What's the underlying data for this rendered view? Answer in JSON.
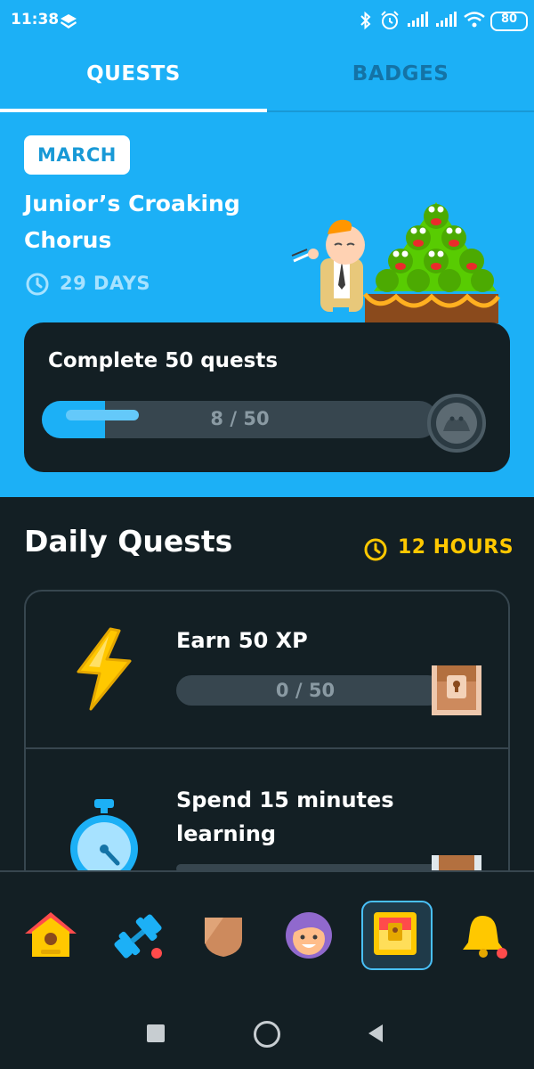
{
  "status_bar": {
    "time": "11:38",
    "battery": "80"
  },
  "tabs": [
    {
      "label": "QUESTS",
      "active": true
    },
    {
      "label": "BADGES",
      "active": false
    }
  ],
  "monthly_challenge": {
    "month": "MARCH",
    "title": "Junior’s Croaking Chorus",
    "days_left": "29 DAYS",
    "card_title": "Complete 50 quests",
    "progress_text": "8 / 50",
    "progress_fraction": 0.16
  },
  "daily_quests": {
    "title": "Daily Quests",
    "time_left": "12 HOURS",
    "items": [
      {
        "title": "Earn 50 XP",
        "progress_text": "0 / 50",
        "progress_fraction": 0,
        "icon": "lightning-icon"
      },
      {
        "title": "Spend 15 minutes learning",
        "icon": "stopwatch-icon"
      }
    ]
  },
  "bottom_nav": [
    {
      "name": "home",
      "icon": "birdhouse-icon",
      "active": false
    },
    {
      "name": "practice",
      "icon": "dumbbell-icon",
      "active": false
    },
    {
      "name": "leagues",
      "icon": "shield-icon",
      "active": false
    },
    {
      "name": "profile",
      "icon": "avatar-icon",
      "active": false
    },
    {
      "name": "quests",
      "icon": "treasure-chest-icon",
      "active": true
    },
    {
      "name": "notifications",
      "icon": "bell-icon",
      "active": false
    }
  ],
  "colors": {
    "brand_blue": "#1cb0f6",
    "dark_bg": "#131f24",
    "gold": "#ffc800"
  }
}
